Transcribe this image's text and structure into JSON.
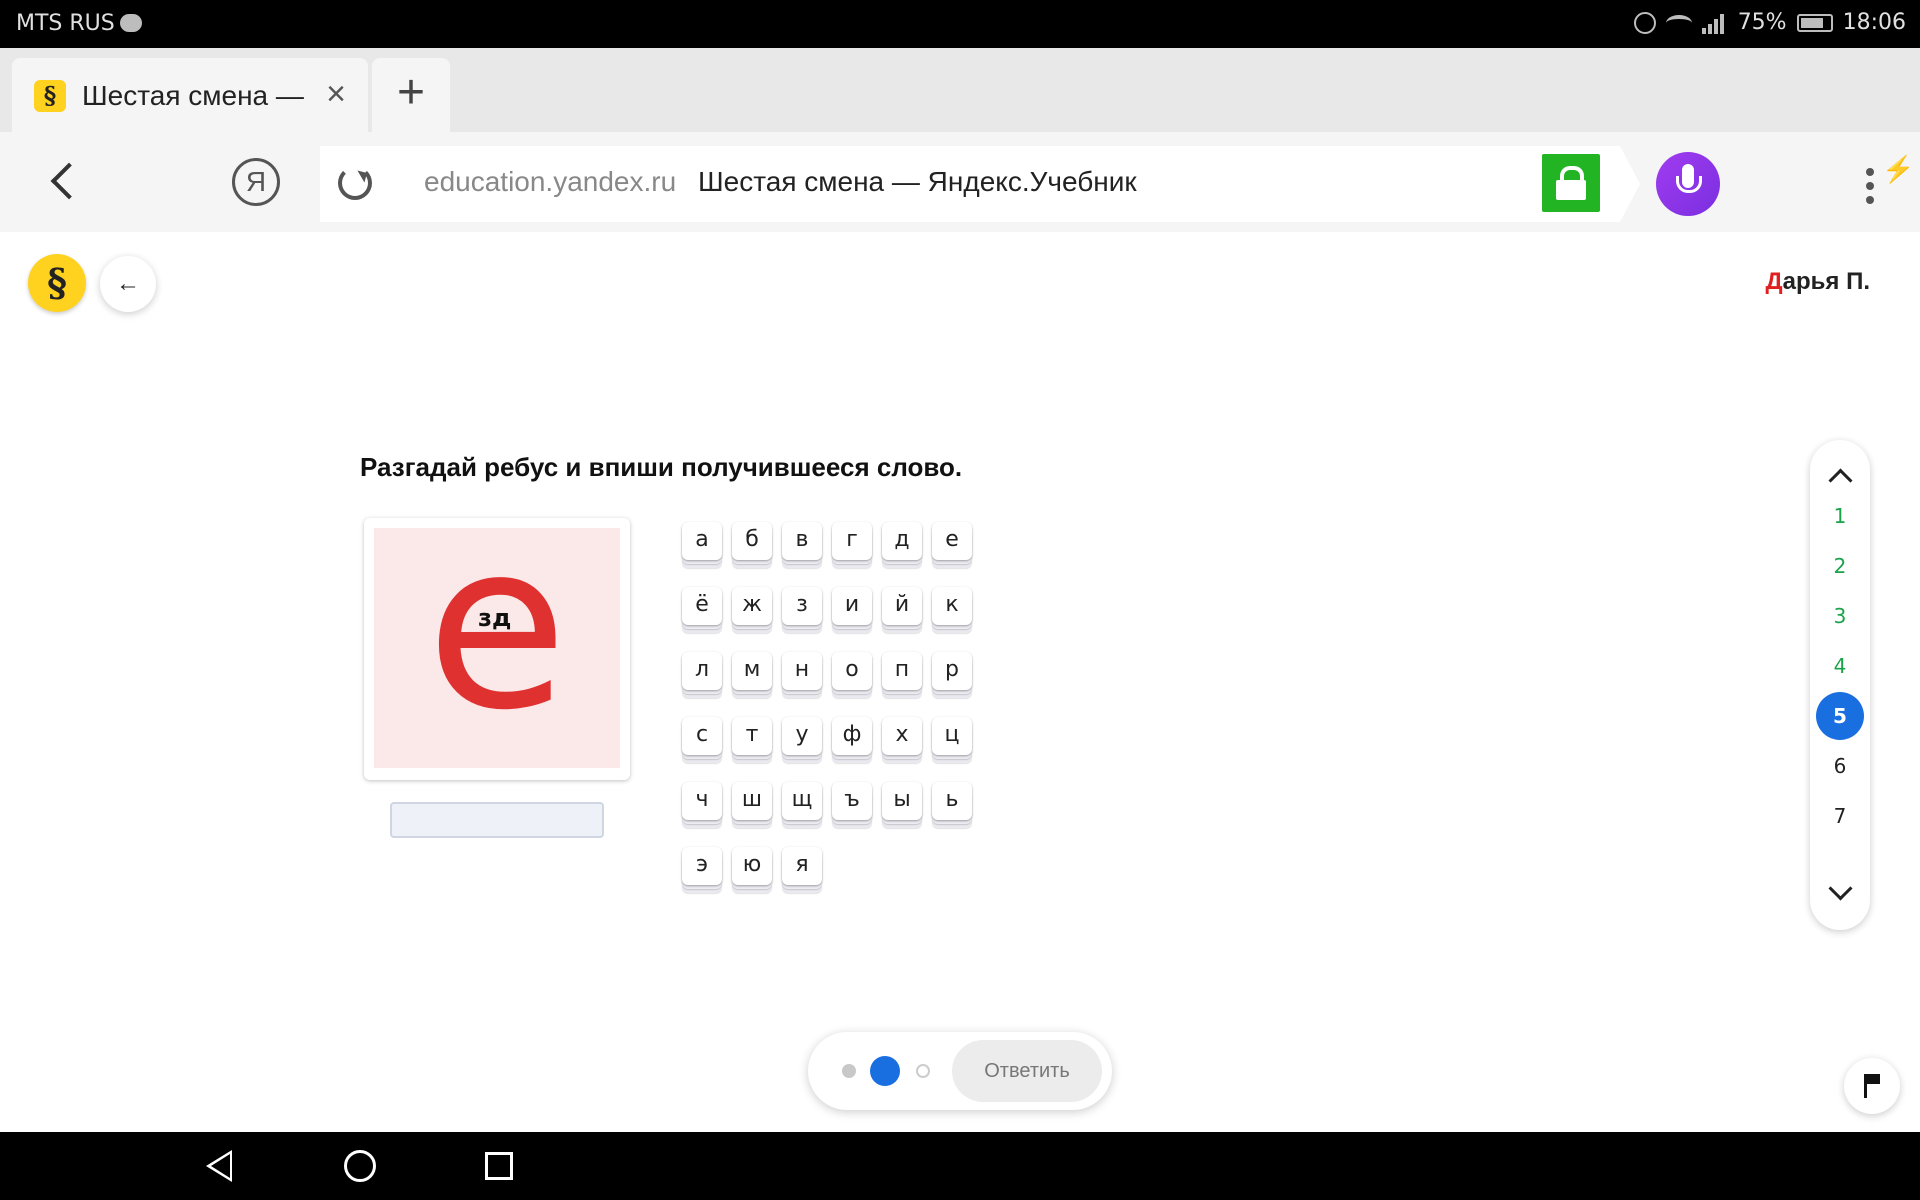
{
  "status_bar": {
    "carrier": "MTS RUS",
    "battery": "75%",
    "time": "18:06"
  },
  "browser": {
    "tab": {
      "favicon": "§",
      "title": "Шестая смена —"
    },
    "address": {
      "domain": "education.yandex.ru",
      "title": "Шестая смена — Яндекс.Учебник"
    },
    "yandex_button": "Я",
    "colors": {
      "lock": "#22b422",
      "alice": "#8a2be2",
      "menu_badge": "#ff5a1f"
    }
  },
  "page": {
    "logo": "§",
    "back_arrow": "←",
    "user": {
      "initial": "Д",
      "rest": "арья П."
    },
    "question": "Разгадай ребус и впиши получившееся слово.",
    "rebus": {
      "big_letter": "е",
      "inner_text": "зд"
    },
    "answer": {
      "value": "",
      "placeholder": ""
    },
    "keyboard": [
      "а",
      "б",
      "в",
      "г",
      "д",
      "е",
      "ё",
      "ж",
      "з",
      "и",
      "й",
      "к",
      "л",
      "м",
      "н",
      "о",
      "п",
      "р",
      "с",
      "т",
      "у",
      "ф",
      "х",
      "ц",
      "ч",
      "ш",
      "щ",
      "ъ",
      "ы",
      "ь",
      "э",
      "ю",
      "я"
    ],
    "pager": {
      "items": [
        "1",
        "2",
        "3",
        "4",
        "5",
        "6",
        "7"
      ],
      "done": [
        "1",
        "2",
        "3",
        "4"
      ],
      "current": "5"
    },
    "submit_label": "Ответить",
    "colors": {
      "accent": "#1a6fe0",
      "done": "#1aa34a",
      "rebus_letter": "#e03131",
      "rebus_bg": "#fbe8e8"
    }
  }
}
